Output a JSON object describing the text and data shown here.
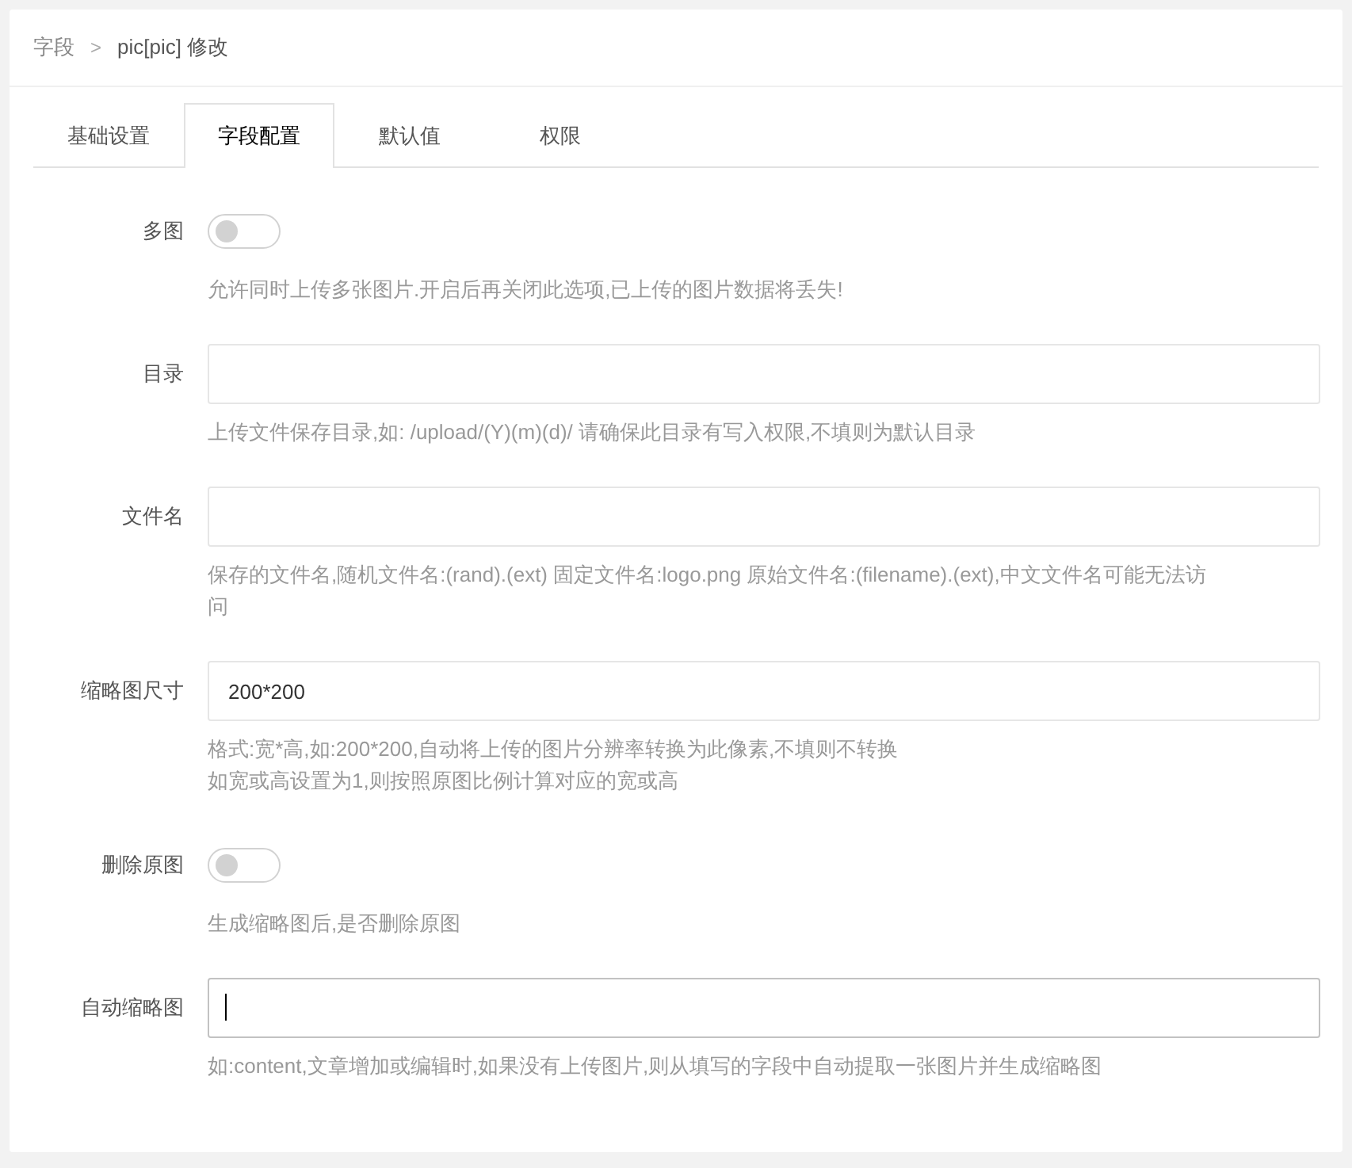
{
  "breadcrumb": {
    "parent": "字段",
    "separator": ">",
    "current": "pic[pic] 修改"
  },
  "tabs": [
    {
      "label": "基础设置",
      "selected": false
    },
    {
      "label": "字段配置",
      "selected": true
    },
    {
      "label": "默认值",
      "selected": false
    },
    {
      "label": "权限",
      "selected": false
    }
  ],
  "fields": [
    {
      "kind": "toggle",
      "label": "多图",
      "on": false,
      "help": [
        "允许同时上传多张图片.开启后再关闭此选项,已上传的图片数据将丢失!"
      ]
    },
    {
      "kind": "input",
      "label": "目录",
      "focused": false,
      "help": [
        "上传文件保存目录,如: /upload/(Y)(m)(d)/ 请确保此目录有写入权限,不填则为默认目录"
      ]
    },
    {
      "kind": "input",
      "label": "文件名",
      "focused": false,
      "help": [
        "保存的文件名,随机文件名:(rand).(ext) 固定文件名:logo.png 原始文件名:(filename).(ext),中文文件名可能无法访问"
      ]
    },
    {
      "kind": "input",
      "label": "缩略图尺寸",
      "value": "200*200",
      "focused": false,
      "help": [
        "格式:宽*高,如:200*200,自动将上传的图片分辨率转换为此像素,不填则不转换",
        "如宽或高设置为1,则按照原图比例计算对应的宽或高"
      ]
    },
    {
      "kind": "toggle",
      "label": "删除原图",
      "on": false,
      "help": [
        "生成缩略图后,是否删除原图"
      ]
    },
    {
      "kind": "input",
      "label": "自动缩略图",
      "focused": true,
      "help": [
        "如:content,文章增加或编辑时,如果没有上传图片,则从填写的字段中自动提取一张图片并生成缩略图"
      ]
    }
  ]
}
